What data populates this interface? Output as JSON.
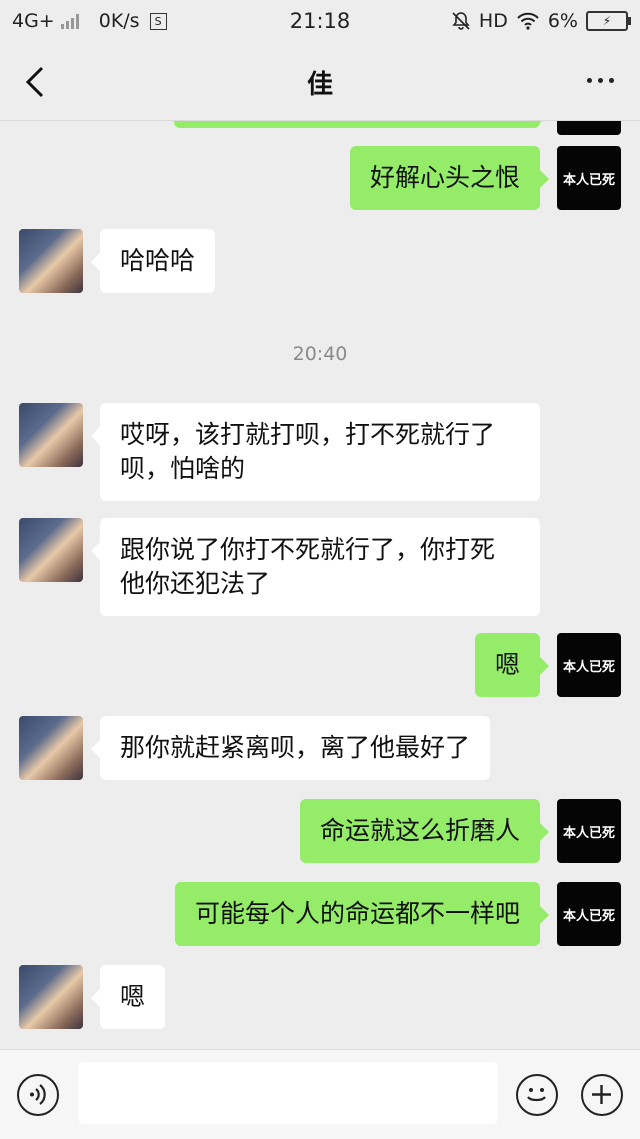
{
  "status_bar": {
    "network": "4G+",
    "speed": "0K/s",
    "s_icon_label": "S",
    "time": "21:18",
    "hd": "HD",
    "battery": "6%"
  },
  "nav": {
    "title": "佳"
  },
  "chat": {
    "timestamp": "20:40",
    "avatar_right_text": "本人已死",
    "messages": [
      {
        "side": "right",
        "text": "好解心头之恨"
      },
      {
        "side": "left",
        "text": "哈哈哈"
      },
      {
        "side": "left",
        "text": "哎呀，该打就打呗，打不死就行了\n呗，怕啥的"
      },
      {
        "side": "left",
        "text": "跟你说了你打不死就行了，你打死\n他你还犯法了"
      },
      {
        "side": "right",
        "text": "嗯"
      },
      {
        "side": "left",
        "text": "那你就赶紧离呗，离了他最好了"
      },
      {
        "side": "right",
        "text": "命运就这么折磨人"
      },
      {
        "side": "right",
        "text": "可能每个人的命运都不一样吧"
      },
      {
        "side": "left",
        "text": "嗯"
      }
    ]
  },
  "input": {
    "value": "",
    "placeholder": ""
  }
}
